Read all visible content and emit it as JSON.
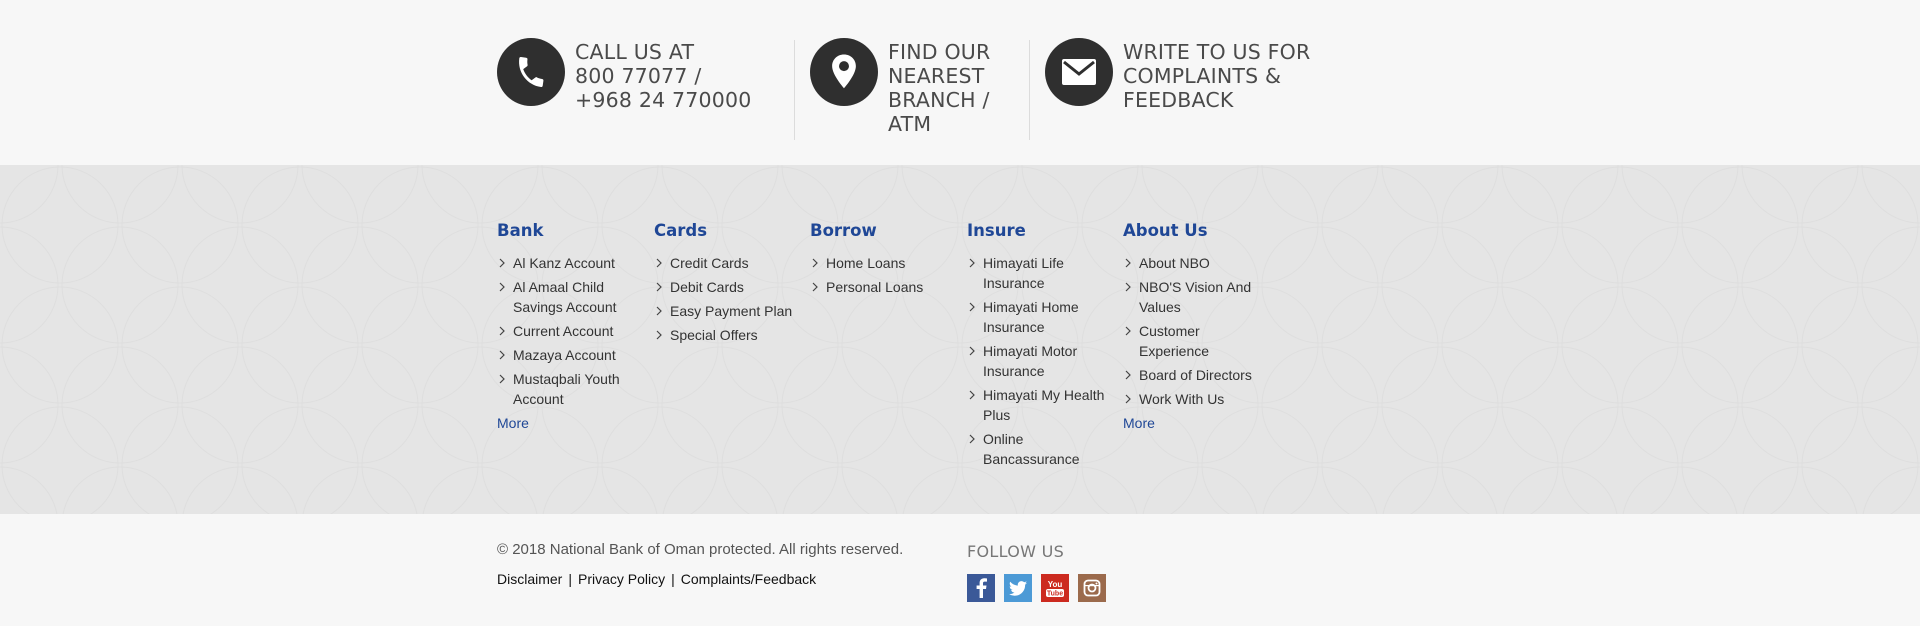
{
  "contact": [
    {
      "icon": "phone-icon",
      "lines": [
        "CALL US AT",
        "800 77077 /",
        "+968 24 770000"
      ]
    },
    {
      "icon": "map-pin-icon",
      "lines": [
        "FIND OUR",
        "NEAREST",
        "BRANCH /",
        "ATM"
      ]
    },
    {
      "icon": "envelope-icon",
      "lines": [
        "WRITE TO US FOR",
        "COMPLAINTS &",
        "FEEDBACK"
      ]
    }
  ],
  "columns": [
    {
      "title": "Bank",
      "items": [
        "Al Kanz Account",
        "Al Amaal Child Savings Account",
        "Current Account",
        "Mazaya Account",
        "Mustaqbali Youth Account"
      ],
      "more": "More"
    },
    {
      "title": "Cards",
      "items": [
        "Credit Cards",
        "Debit Cards",
        "Easy Payment Plan",
        "Special Offers"
      ]
    },
    {
      "title": "Borrow",
      "items": [
        "Home Loans",
        "Personal Loans"
      ]
    },
    {
      "title": "Insure",
      "items": [
        "Himayati Life Insurance",
        "Himayati Home Insurance",
        "Himayati Motor Insurance",
        "Himayati My Health Plus",
        "Online Bancassurance"
      ]
    },
    {
      "title": "About Us",
      "items": [
        "About NBO",
        "NBO'S Vision And Values",
        "Customer Experience",
        "Board of Directors",
        "Work With Us"
      ],
      "more": "More"
    }
  ],
  "footer": {
    "copyright": "© 2018 National Bank of Oman protected. All rights reserved.",
    "links": [
      "Disclaimer",
      "Privacy Policy",
      "Complaints/Feedback"
    ],
    "separator": "|",
    "follow_title": "FOLLOW US",
    "social": [
      {
        "name": "facebook-icon",
        "color": "#3b5998"
      },
      {
        "name": "twitter-icon",
        "color": "#4c9ad6"
      },
      {
        "name": "youtube-icon",
        "color": "#cc2a1f"
      },
      {
        "name": "instagram-icon",
        "color": "#9b6a4c"
      }
    ]
  },
  "colors": {
    "heading": "#1f4796",
    "icon_circle": "#2f2f2f",
    "band_gray": "#e5e5e5"
  }
}
